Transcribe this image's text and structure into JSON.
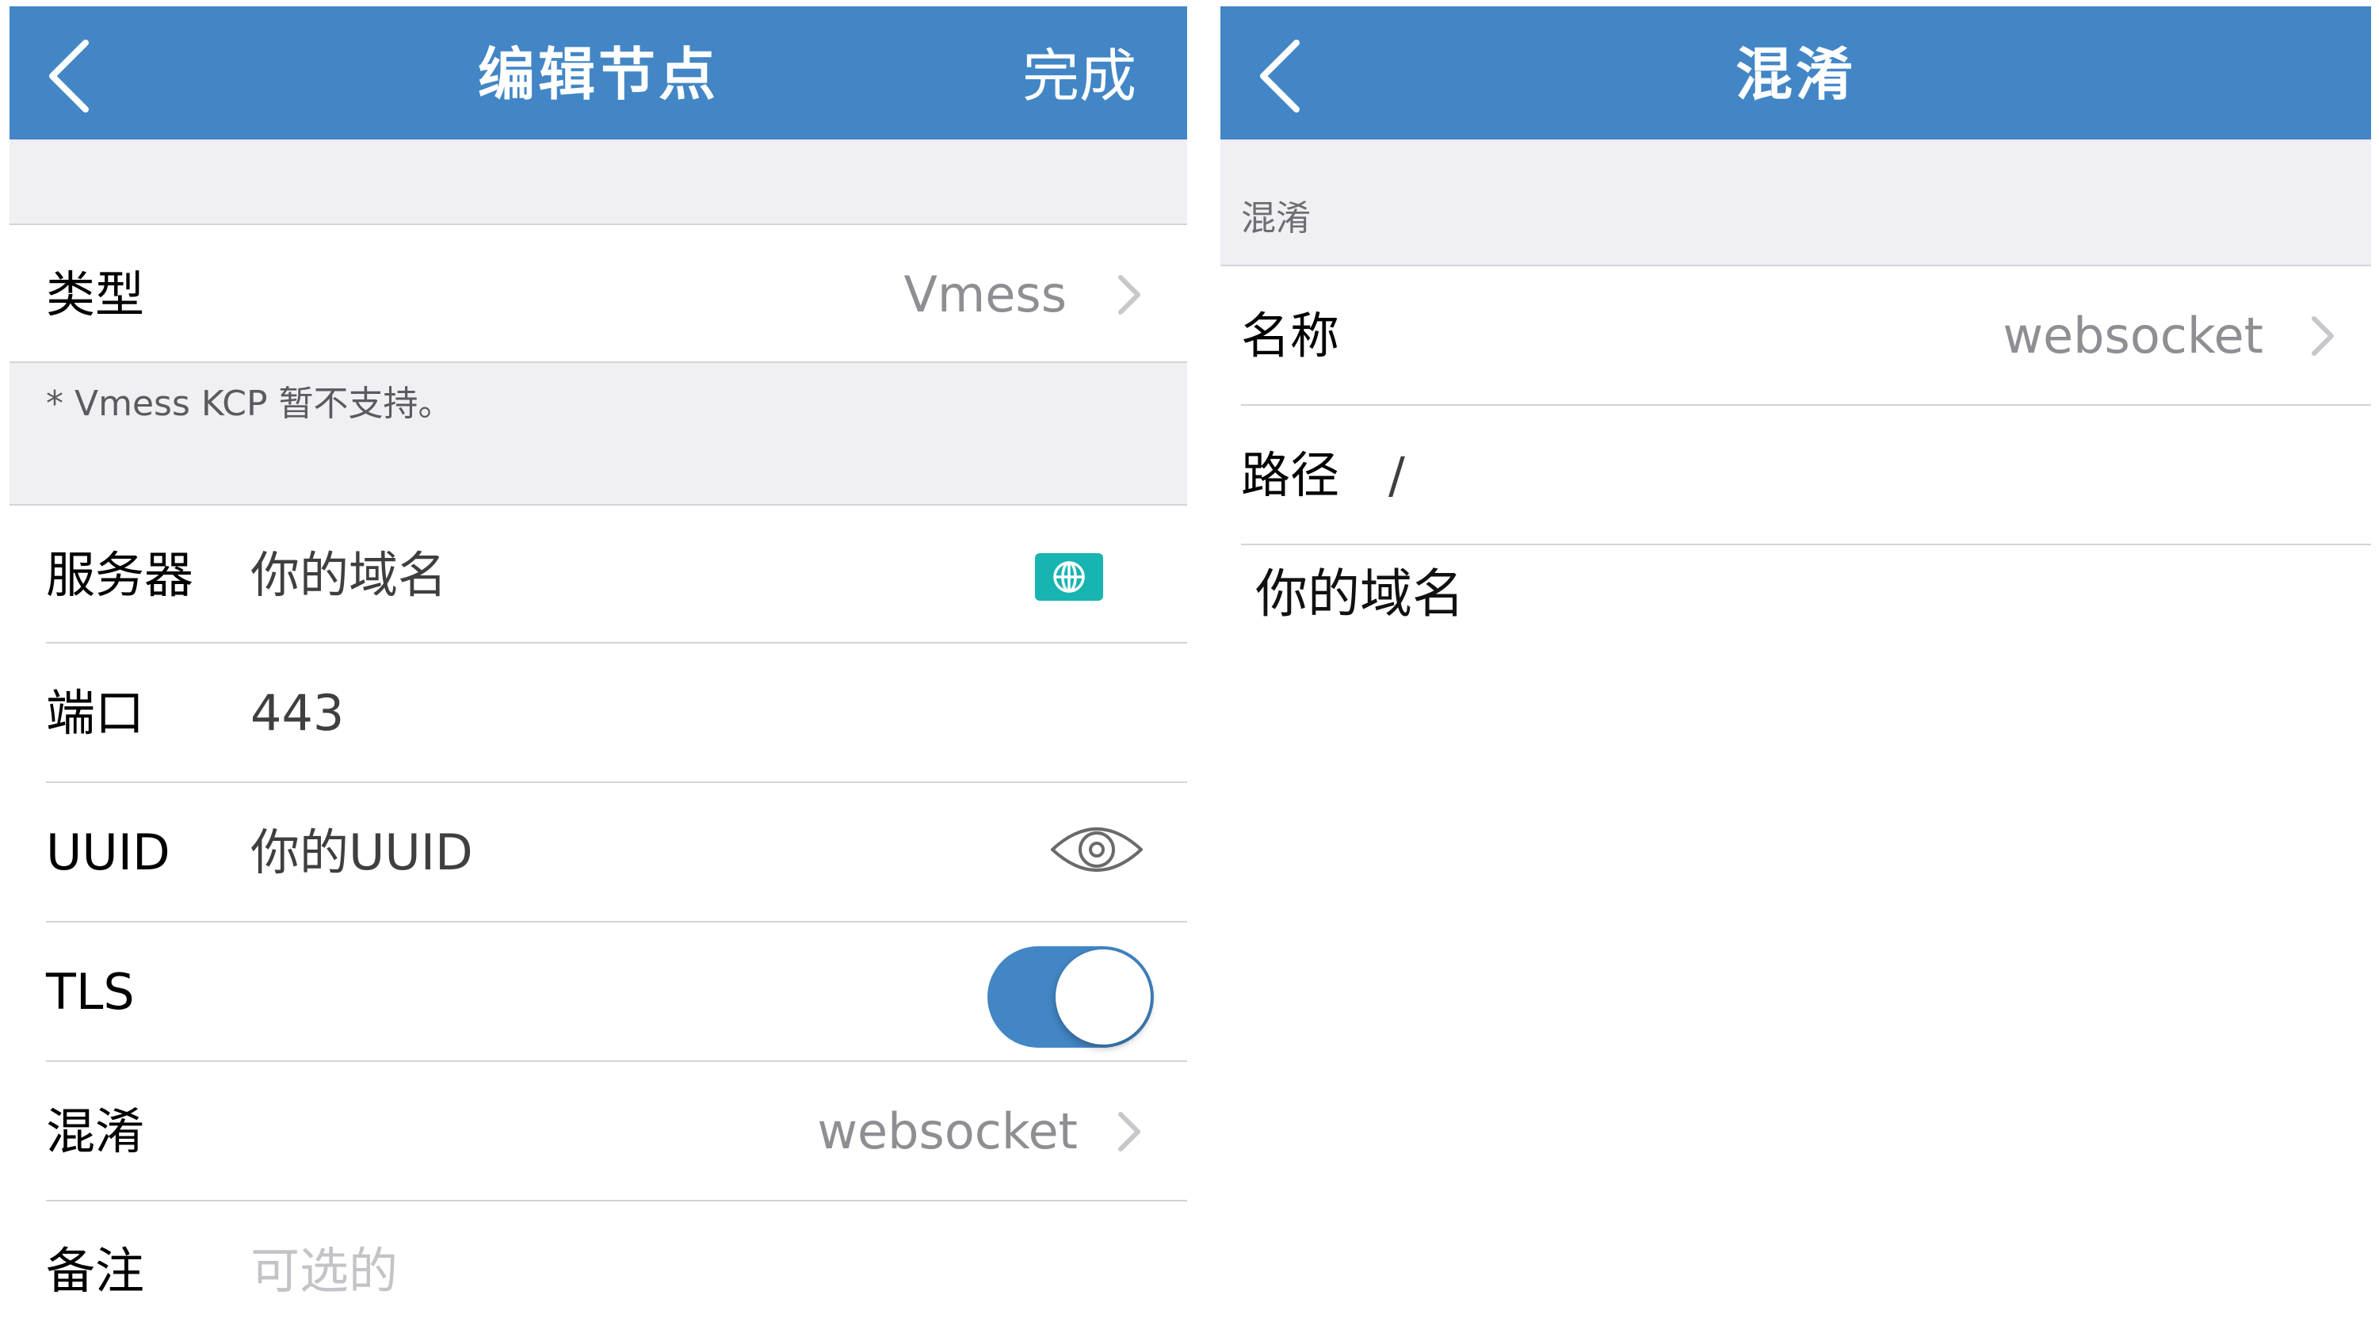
{
  "left_screen": {
    "navbar": {
      "back_icon": "chevron-left-icon",
      "title": "编辑节点",
      "done_label": "完成",
      "color": "#4286c6"
    },
    "type_row": {
      "label": "类型",
      "value": "Vmess",
      "icon": "chevron-right-icon"
    },
    "note": "* Vmess KCP 暂不支持。",
    "server_row": {
      "label": "服务器",
      "value": "你的域名",
      "icon": "globe-icon",
      "icon_color": "#18b4b1"
    },
    "port_row": {
      "label": "端口",
      "value": "443"
    },
    "uuid_row": {
      "label": "UUID",
      "value": "你的UUID",
      "icon": "eye-icon"
    },
    "tls_row": {
      "label": "TLS",
      "toggle_on": true
    },
    "obfs_row": {
      "label": "混淆",
      "value": "websocket",
      "icon": "chevron-right-icon"
    },
    "remark_row": {
      "label": "备注",
      "placeholder": "可选的"
    }
  },
  "right_screen": {
    "navbar": {
      "back_icon": "chevron-left-icon",
      "title": "混淆",
      "color": "#4286c6"
    },
    "section_header": "混淆",
    "name_row": {
      "label": "名称",
      "value": "websocket",
      "icon": "chevron-right-icon"
    },
    "path_row": {
      "label": "路径",
      "value": "/"
    },
    "host_text": "你的域名"
  }
}
